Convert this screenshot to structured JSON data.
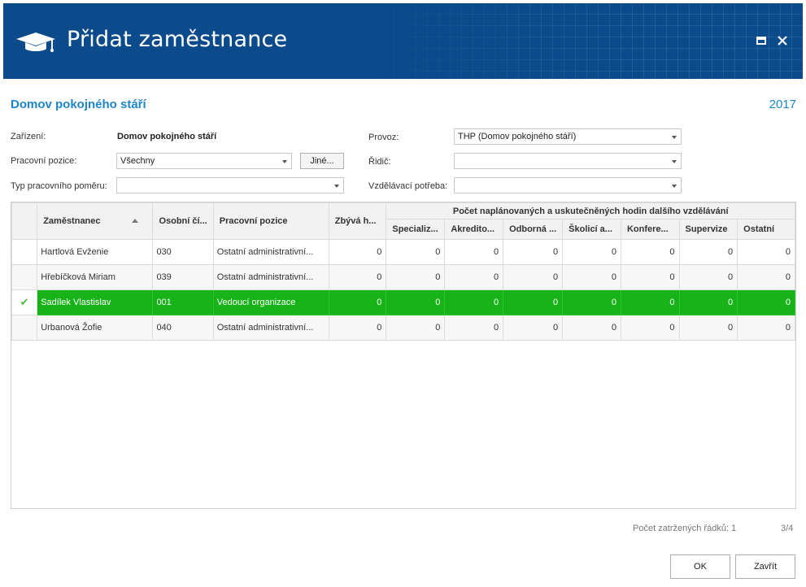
{
  "window": {
    "title": "Přidat zaměstnance"
  },
  "header": {
    "org": "Domov pokojného stáří",
    "year": "2017"
  },
  "form": {
    "zarizeni_label": "Zařízení:",
    "zarizeni_value": "Domov pokojného stáří",
    "pozice_label": "Pracovní pozice:",
    "pozice_value": "Všechny",
    "jine_button": "Jiné...",
    "typ_label": "Typ pracovního poměru:",
    "typ_value": "",
    "provoz_label": "Provoz:",
    "provoz_value": "THP (Domov pokojného stáří)",
    "ridic_label": "Řidič:",
    "ridic_value": "",
    "vzdelavaci_label": "Vzdělávací potřeba:",
    "vzdelavaci_value": ""
  },
  "grid": {
    "group_header": "Počet naplánovaných a uskutečněných hodin dalšího vzdělávání",
    "columns": {
      "zamestnanec": "Zaměstnanec",
      "osobni": "Osobní čí...",
      "pozice": "Pracovní pozice",
      "zbyva": "Zbývá h...",
      "specializ": "Specializ...",
      "akredito": "Akredito...",
      "odborna": "Odborná ...",
      "skolici": "Školicí a...",
      "konfere": "Konfere...",
      "supervize": "Supervize",
      "ostatni": "Ostatní"
    },
    "rows": [
      {
        "name": "Hartlová Evženie",
        "id": "030",
        "position": "Ostatní administrativní...",
        "zbyva": "0",
        "specializ": "0",
        "akredito": "0",
        "odborna": "0",
        "skolici": "0",
        "konfere": "0",
        "supervize": "0",
        "ostatni": "0"
      },
      {
        "name": "Hřebíčková Miriam",
        "id": "039",
        "position": "Ostatní administrativní...",
        "zbyva": "0",
        "specializ": "0",
        "akredito": "0",
        "odborna": "0",
        "skolici": "0",
        "konfere": "0",
        "supervize": "0",
        "ostatni": "0"
      },
      {
        "name": "Sadílek Vlastislav",
        "id": "001",
        "position": "Vedoucí organizace",
        "zbyva": "0",
        "specializ": "0",
        "akredito": "0",
        "odborna": "0",
        "skolici": "0",
        "konfere": "0",
        "supervize": "0",
        "ostatni": "0",
        "check": "✔"
      },
      {
        "name": "Urbanová Žofie",
        "id": "040",
        "position": "Ostatní administrativní...",
        "zbyva": "0",
        "specializ": "0",
        "akredito": "0",
        "odborna": "0",
        "skolici": "0",
        "konfere": "0",
        "supervize": "0",
        "ostatni": "0"
      }
    ]
  },
  "footer": {
    "checked_rows": "Počet zatržených řádků: 1",
    "position": "3/4",
    "ok": "OK",
    "close": "Zavřít"
  },
  "icons": {
    "title_icon": "graduation-cap-icon",
    "maximize": "maximize-icon",
    "close": "close-icon",
    "check": "checkmark-icon",
    "sort": "sort-ascending-icon",
    "dropdown": "chevron-down-icon"
  },
  "colors": {
    "titlebar": "#0b4b8c",
    "accent": "#1d86c9",
    "selected_row": "#18b318"
  }
}
